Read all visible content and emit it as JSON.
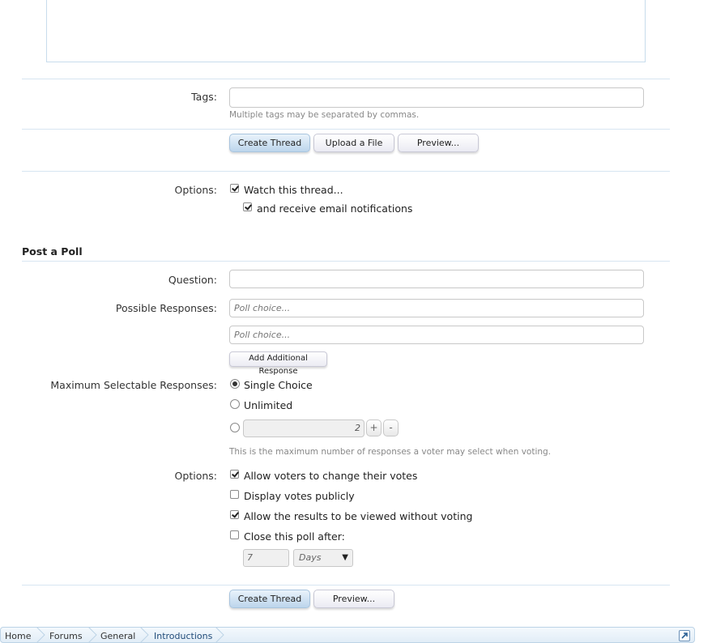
{
  "tags": {
    "label": "Tags:",
    "explain": "Multiple tags may be separated by commas.",
    "value": ""
  },
  "actions_top": {
    "create": "Create Thread",
    "upload": "Upload a File",
    "preview": "Preview..."
  },
  "options_thread": {
    "label": "Options:",
    "watch": "Watch this thread...",
    "email": "and receive email notifications"
  },
  "poll": {
    "title": "Post a Poll",
    "question_label": "Question:",
    "responses_label": "Possible Responses:",
    "choice_placeholder": "Poll choice...",
    "add_response": "Add Additional Response",
    "max_label": "Maximum Selectable Responses:",
    "single": "Single Choice",
    "unlimited": "Unlimited",
    "count_value": "2",
    "plus": "+",
    "minus": "-",
    "max_explain": "This is the maximum number of responses a voter may select when voting.",
    "options_label": "Options:",
    "opt_change": "Allow voters to change their votes",
    "opt_public": "Display votes publicly",
    "opt_results": "Allow the results to be viewed without voting",
    "opt_close": "Close this poll after:",
    "close_value": "7",
    "close_unit": "Days"
  },
  "actions_bottom": {
    "create": "Create Thread",
    "preview": "Preview..."
  },
  "breadcrumb": [
    "Home",
    "Forums",
    "General",
    "Introductions"
  ],
  "icons": {
    "select_arrow": "▼",
    "jump": "↗"
  }
}
